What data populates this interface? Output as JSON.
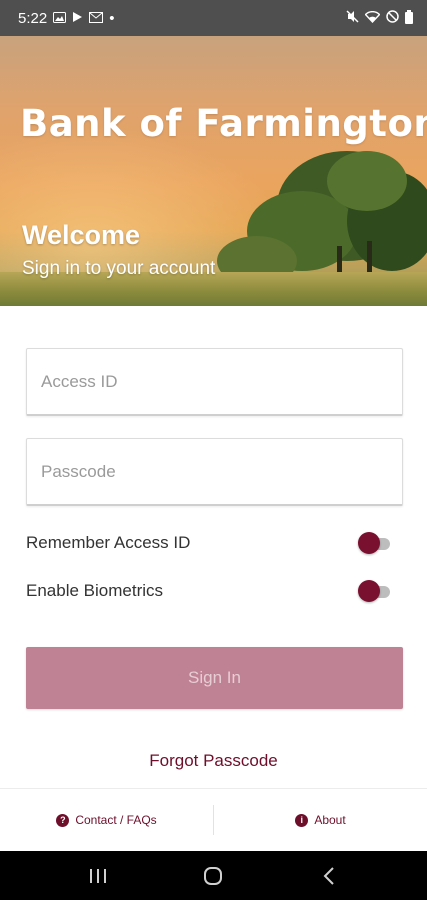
{
  "status_bar": {
    "time": "5:22",
    "dot": "•",
    "left_icons": [
      "image-icon",
      "play-store-icon",
      "mail-icon"
    ],
    "right_icons": [
      "mute-icon",
      "wifi-icon",
      "dnd-icon",
      "battery-icon"
    ]
  },
  "hero": {
    "brand": "Bank of Farmington",
    "welcome": "Welcome",
    "subtitle": "Sign in to your account"
  },
  "form": {
    "access_placeholder": "Access ID",
    "access_value": "",
    "passcode_placeholder": "Passcode",
    "passcode_value": "",
    "remember_label": "Remember Access ID",
    "remember_on": false,
    "biometrics_label": "Enable Biometrics",
    "biometrics_on": false,
    "signin_label": "Sign In",
    "forgot_label": "Forgot Passcode"
  },
  "bottom_bar": {
    "contact_label": "Contact / FAQs",
    "about_label": "About"
  },
  "colors": {
    "brand_maroon": "#6d0f2b",
    "toggle_thumb": "#7a1030",
    "signin_disabled": "#bf8294"
  }
}
